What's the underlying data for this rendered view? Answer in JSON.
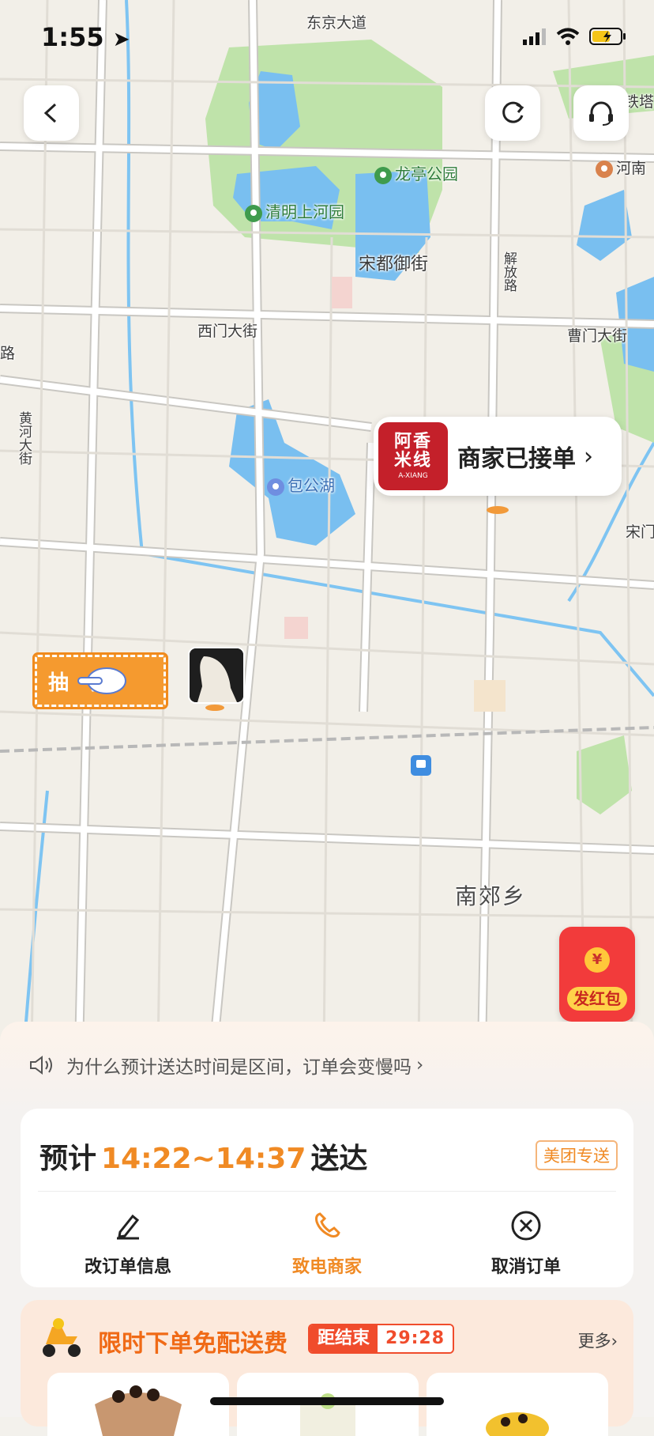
{
  "status_bar": {
    "time": "1:55"
  },
  "map": {
    "labels": {
      "east_road": "东京大道",
      "longting_park": "龙亭公园",
      "qingming_garden": "清明上河园",
      "songdu_street": "宋都御街",
      "jiefang_road": "解放路",
      "ximen_street": "西门大街",
      "caomen_street": "曹门大街",
      "road_left": "路",
      "huanghe_street": "黄河大街",
      "baogong_lake": "包公湖",
      "songmen": "宋门",
      "nanjiao": "南郊乡",
      "henan": "河南",
      "tieta": "铁塔"
    },
    "merchant": {
      "logo_text": "阿香米线",
      "logo_en": "A-XIANG",
      "status": "商家已接单"
    },
    "lottery_label": "抽奖",
    "red_packet_label": "发红包",
    "red_packet_coin": "¥"
  },
  "sheet": {
    "notice": "为什么预计送达时间是区间，订单会变慢吗",
    "eta_prefix": "预计",
    "eta_range": "14:22~14:37",
    "eta_suffix": "送达",
    "badge": "美团专送",
    "actions": {
      "edit": "改订单信息",
      "call": "致电商家",
      "cancel": "取消订单"
    },
    "promo": {
      "title": "限时下单免配送费",
      "countdown_label": "距结束",
      "countdown_time": "29:28",
      "more": "更多"
    }
  },
  "colors": {
    "accent": "#f08a24",
    "red": "#f23b3b",
    "water": "#6fb6ef",
    "park": "#b9e0a3"
  }
}
